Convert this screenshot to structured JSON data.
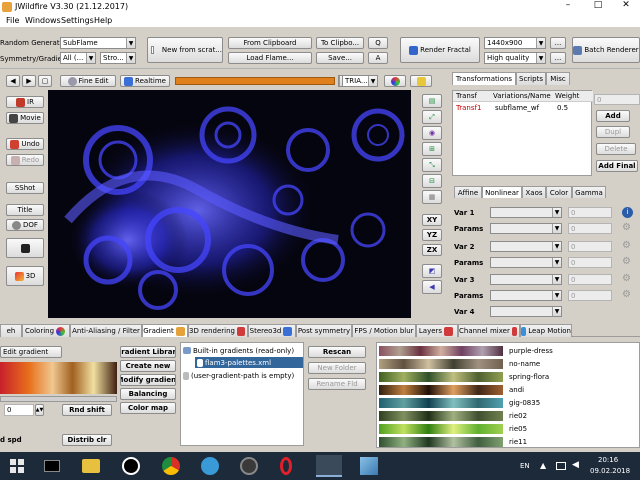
{
  "window": {
    "title": "JWildfire V3.30 (21.12.2017)",
    "controls": [
      "–",
      "□",
      "✕"
    ]
  },
  "menu": [
    "File",
    "Windows",
    "Settings",
    "Help"
  ],
  "toolbar": {
    "random_generator_label": "Random Generator",
    "random_generator_value": "SubFlame",
    "symmetry_label": "Symmetry/Gradient",
    "symmetry_value": "All (...",
    "stroke_value": "Stro...",
    "new_from_scratch": "New from scrat...",
    "from_clipboard": "From Clipboard",
    "load_flame": "Load Flame...",
    "to_clipboard": "To Clipbo...",
    "save": "Save...",
    "q_label": "Q",
    "a_label": "A",
    "render_fractal": "Render Fractal",
    "resolution": "1440x900",
    "quality": "High quality",
    "dots": "...",
    "batch_renderer": "Batch Renderer"
  },
  "edit_bar": {
    "fine_edit": "Fine Edit",
    "realtime": "Realtime",
    "tria": "TRIA..."
  },
  "left_buttons": [
    "IR",
    "Movie",
    "Undo",
    "Redo",
    "SShot",
    "Title",
    "DOF",
    "",
    "3D"
  ],
  "right_tool_buttons": [
    "XY",
    "YZ",
    "ZX"
  ],
  "transform_panel": {
    "tabs": [
      "Transformations",
      "Scripts",
      "Misc"
    ],
    "columns": [
      "Transf",
      "Variations/Name",
      "Weight"
    ],
    "rows": [
      {
        "transf": "Transf1",
        "name": "subflame_wf",
        "weight": "0.5"
      }
    ],
    "field_value": "0",
    "buttons": [
      "Add",
      "Dupl",
      "Delete",
      "Add Final"
    ],
    "sub_tabs": [
      "Affine",
      "Nonlinear",
      "Xaos",
      "Color",
      "Gamma"
    ],
    "vars": [
      {
        "var": "Var 1",
        "params": "Params",
        "value": "0"
      },
      {
        "var": "Var 2",
        "params": "Params",
        "value": "0"
      },
      {
        "var": "Var 3",
        "params": "Params",
        "value": "0"
      },
      {
        "var": "Var 4",
        "params": ""
      }
    ]
  },
  "bottom_tabs": [
    "eh",
    "Coloring",
    "Anti-Aliasing / Filter",
    "Gradient",
    "3D rendering",
    "Stereo3d",
    "Post symmetry",
    "FPS / Motion blur",
    "Layers",
    "Channel mixer",
    "Leap Motion"
  ],
  "gradient_panel": {
    "edit_gradient": "Edit gradient",
    "spinner_value": "0",
    "rnd_shift": "Rnd shift",
    "spd_label": "d spd",
    "distrib_clr": "Distrib clr",
    "lib_buttons": [
      "Gradient Library",
      "Create new",
      "Modify gradient",
      "Balancing",
      "Color map"
    ],
    "tree": [
      "Built-in gradients (read-only)",
      "flam3-palettes.xml",
      "(user-gradient-path is empty)"
    ],
    "folder_buttons": [
      "Rescan",
      "New Folder",
      "Rename Fld"
    ],
    "gradients": [
      "purple-dress",
      "no-name",
      "spring-flora",
      "andi",
      "gig-0835",
      "rie02",
      "rie05",
      "rie11"
    ]
  },
  "taskbar": {
    "lang": "EN",
    "time": "20:16",
    "date": "09.02.2018"
  },
  "colors": {
    "accent": "#3399ff",
    "selected": "#33669a",
    "red_text": "#cc0000",
    "flame": "#3a3aff"
  }
}
